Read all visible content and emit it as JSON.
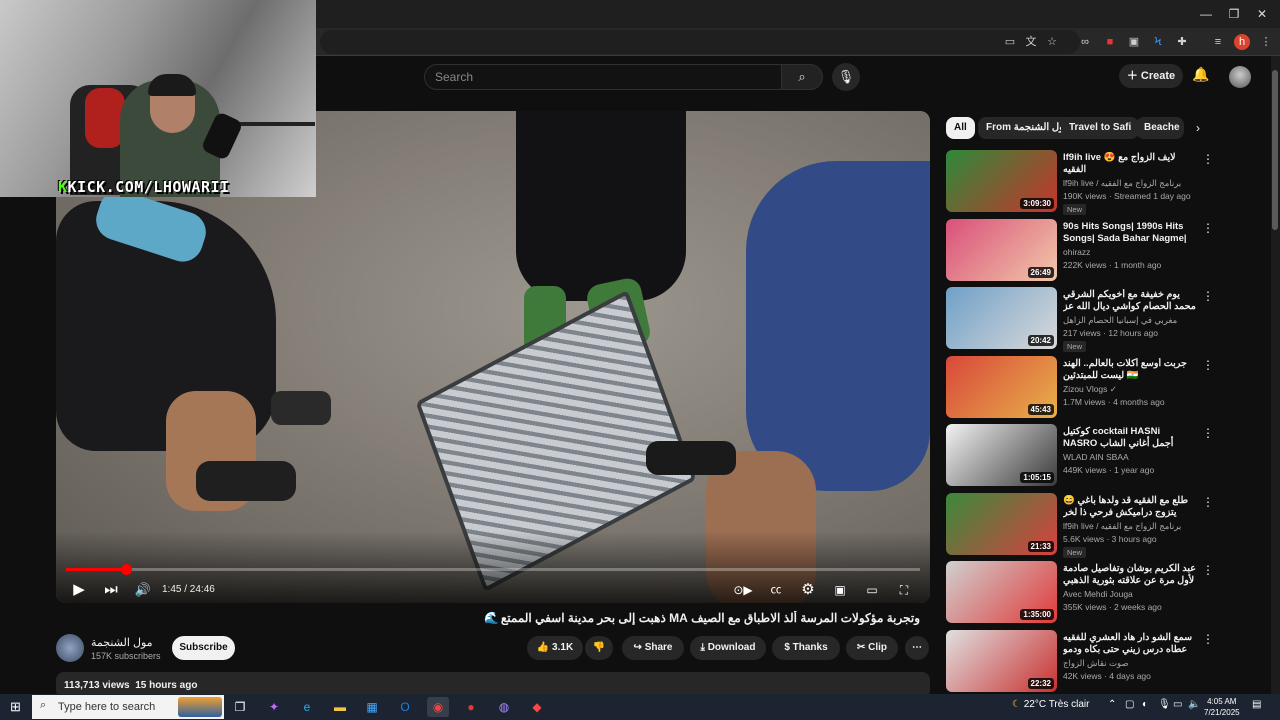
{
  "browser": {
    "window_controls": [
      "—",
      "❐",
      "✕"
    ],
    "profile_initial": "h"
  },
  "webcam": {
    "overlay_text_k": "K",
    "overlay_text": "KICK.COM/LHOWARII"
  },
  "header": {
    "search_placeholder": "Search",
    "create_label": "Create"
  },
  "player": {
    "time": "1:45 / 24:46",
    "progress_fraction": 0.0707
  },
  "video": {
    "title": "وتجربة مؤكولات المرسة ألذ الاطباق مع الصيف MA ذهبت إلى بحر مدينة اسفي الممتع بحر عائلي ...",
    "title_emoji": "🌊",
    "channel_name": "مول الشنجمة",
    "subscribers": "157K subscribers",
    "subscribe_label": "Subscribe",
    "likes": "3.1K",
    "share_label": "Share",
    "download_label": "Download",
    "thanks_label": "Thanks",
    "clip_label": "Clip",
    "views": "113,713 views",
    "age": "15 hours ago"
  },
  "chips": [
    {
      "label": "All",
      "active": true
    },
    {
      "label": "From مول الشنجمة",
      "active": false
    },
    {
      "label": "Travel to Safi",
      "active": false
    },
    {
      "label": "Beache",
      "active": false
    }
  ],
  "recommendations": [
    {
      "title": "lf9ih live 😍 لايف الزواج مع الفقيه",
      "channel": "lf9ih live / برنامج الزواج مع الفقيه",
      "meta": "190K views · Streamed 1 day ago",
      "badge": "New",
      "duration": "3:09:30",
      "thumb_colors": [
        "#2d8a3a",
        "#c7342c"
      ]
    },
    {
      "title": "90s Hits Songs| 1990s Hits Songs| Sada Bahar Nagme| Sr...",
      "channel": "ohirazz",
      "meta": "222K views · 1 month ago",
      "badge": "",
      "duration": "26:49",
      "thumb_colors": [
        "#d9507a",
        "#f2c8a8"
      ]
    },
    {
      "title": "يوم خفيفة مع أخويكم الشرقي محمد الحصام كواشي ديال الله عز وجل في إسبانيا 🤲 ...",
      "channel": "مغربي في إسبانيا الحصام الزاهل",
      "meta": "217 views · 12 hours ago",
      "badge": "New",
      "duration": "20:42",
      "thumb_colors": [
        "#6fa0c8",
        "#d9d9d9"
      ]
    },
    {
      "title": "جربت أوسع أكلات بالعالم.. الهند ليست للمبتدئين 🇮🇳",
      "channel": "Zizou Vlogs ✓",
      "meta": "1.7M views · 4 months ago",
      "badge": "",
      "duration": "45:43",
      "thumb_colors": [
        "#d8483a",
        "#e8b04a"
      ]
    },
    {
      "title": "كوكتيل cocktail HASNi NASRO أجمل أغاني الشاب حسني و نصرو",
      "channel": "WLAD AIN SBAA",
      "meta": "449K views · 1 year ago",
      "badge": "",
      "duration": "1:05:15",
      "thumb_colors": [
        "#f3f3f3",
        "#3a3a3a"
      ]
    },
    {
      "title": "😄 طلع مع الفقيه قد ولدها باغي يتزوج دراميكش فرحي ذا لخر",
      "channel": "lf9ih live / برنامج الزواج مع الفقيه",
      "meta": "5.6K views · 3 hours ago",
      "badge": "New",
      "duration": "21:33",
      "thumb_colors": [
        "#3a8a3a",
        "#d84040"
      ]
    },
    {
      "title": "عبد الكريم بوشان وتفاصيل صادمة لأول مرة عن علاقته بثورية الذهبي وكيف قتل من ...",
      "channel": "Avec Mehdi Jouga",
      "meta": "355K views · 2 weeks ago",
      "badge": "",
      "duration": "1:35:00",
      "thumb_colors": [
        "#d0d0d0",
        "#e03a3a"
      ]
    },
    {
      "title": "سمع الشو دار هاد العشري للفقيه عطاه درس زيني حتى بكاه ودمو هاد الحلقة راه نزاف ...",
      "channel": "صوت نقاش الزواج",
      "meta": "42K views · 4 days ago",
      "badge": "",
      "duration": "22:32",
      "thumb_colors": [
        "#e0e0e0",
        "#c93030"
      ]
    }
  ],
  "taskbar": {
    "search_placeholder": "Type here to search",
    "weather": "22°C  Très clair",
    "time": "4:05 AM",
    "date": "7/21/2025"
  }
}
